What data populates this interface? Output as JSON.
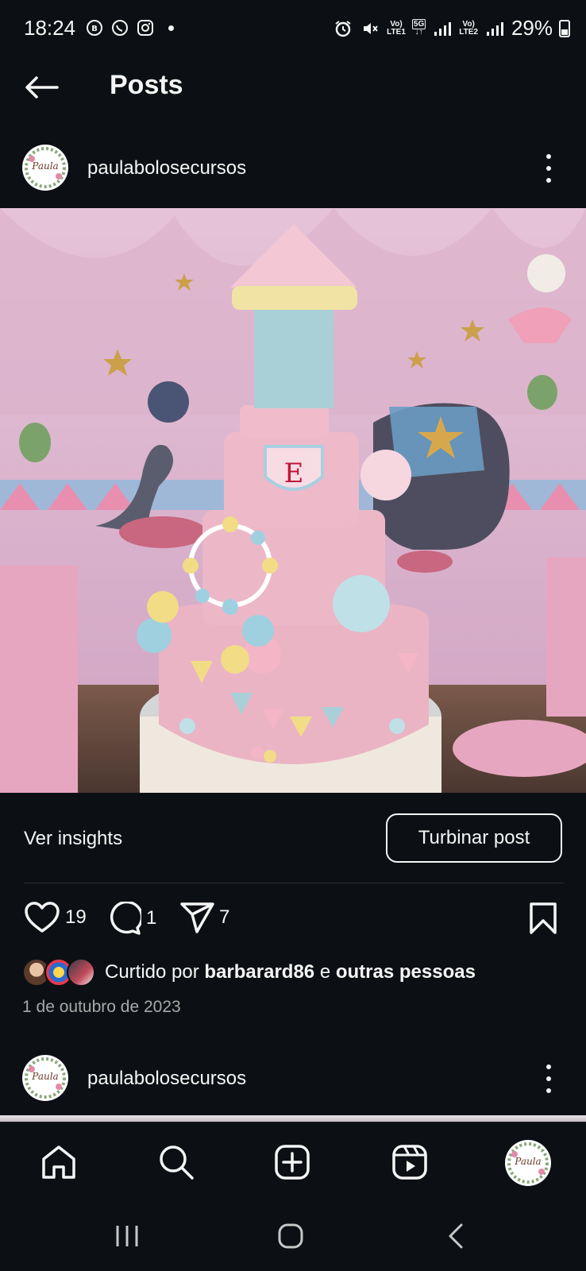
{
  "status_bar": {
    "time": "18:24",
    "net_label_1": "LTE1",
    "net_label_2": "LTE2",
    "net_badge": "5G",
    "battery": "29%"
  },
  "header": {
    "title": "Posts"
  },
  "post": {
    "username": "paulabolosecursos",
    "image_alt": "cake",
    "insights_label": "Ver insights",
    "boost_label": "Turbinar post",
    "likes_count": "19",
    "comments_count": "1",
    "shares_count": "7",
    "liked_prefix": "Curtido por",
    "liked_user": "barbarard86",
    "liked_connector": "e",
    "liked_suffix": "outras pessoas",
    "date": "1 de outubro de 2023"
  },
  "next_post": {
    "username": "paulabolosecursos"
  },
  "bottom_nav": {
    "items": [
      "home-icon",
      "search-icon",
      "create-icon",
      "reels-icon",
      "profile-avatar"
    ]
  },
  "colors": {
    "background": "#0c1014",
    "text": "#f5f5f5",
    "muted": "#a8a8a8",
    "cake_pink": "#e9b3c4",
    "cake_blue": "#a9d0d6",
    "backdrop": "#d6a4c0"
  }
}
